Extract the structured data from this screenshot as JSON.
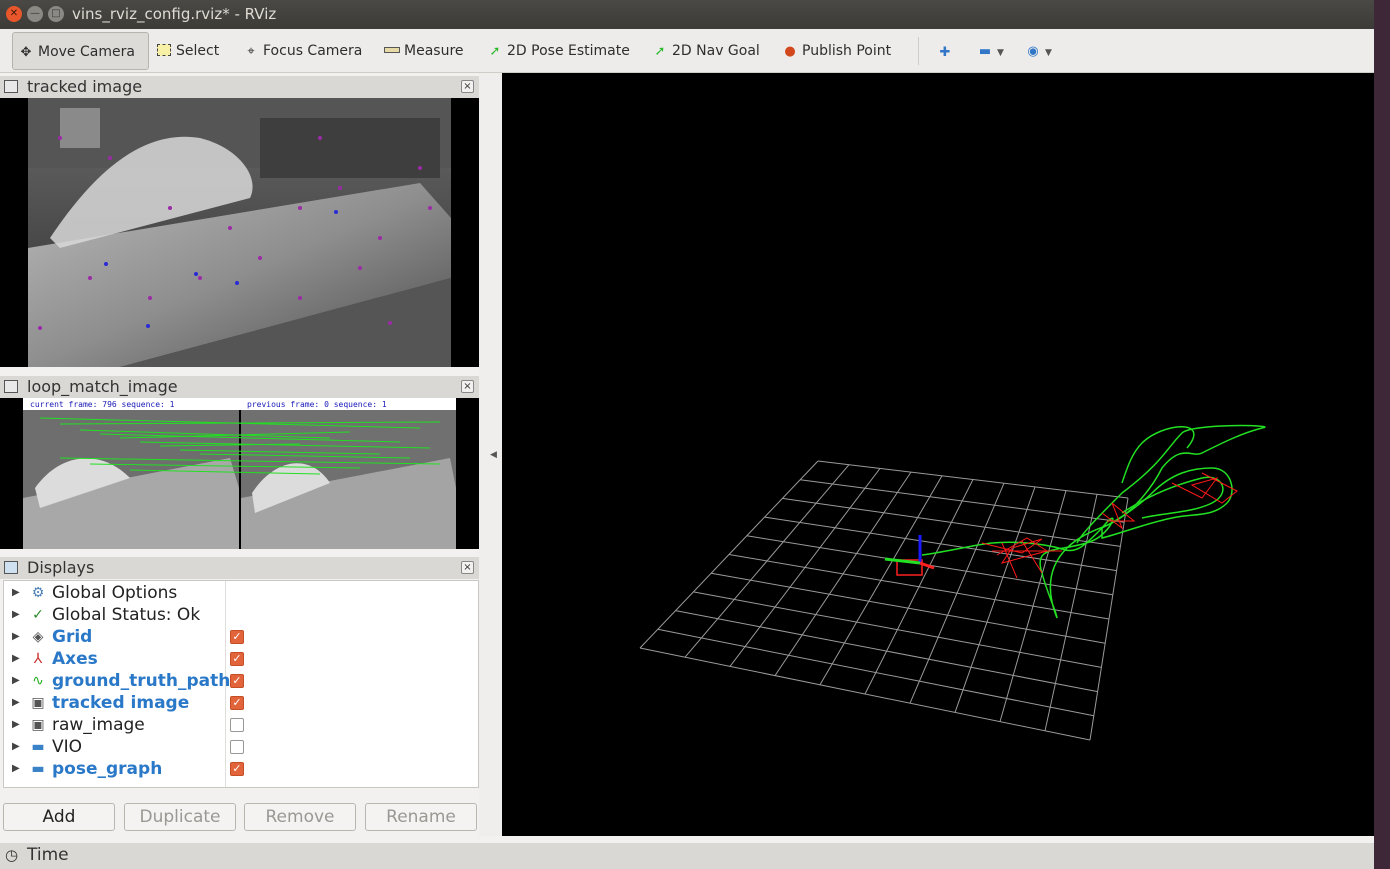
{
  "window": {
    "title": "vins_rviz_config.rviz* - RViz",
    "close": "✕",
    "minimize": "—",
    "maximize": "□"
  },
  "toolbar": {
    "move_camera": "Move Camera",
    "select": "Select",
    "focus_camera": "Focus Camera",
    "measure": "Measure",
    "pose_estimate": "2D Pose Estimate",
    "nav_goal": "2D Nav Goal",
    "publish_point": "Publish Point",
    "icons": [
      "move-camera-icon",
      "select-icon",
      "focus-camera-icon",
      "measure-icon",
      "pose-estimate-icon",
      "nav-goal-icon",
      "publish-point-icon",
      "add-tool-icon",
      "remove-tool-icon",
      "view-icon"
    ]
  },
  "panels": {
    "tracked": {
      "title": "tracked image",
      "close": "×"
    },
    "loop": {
      "title": "loop_match_image",
      "close": "×",
      "left_caption": "current frame: 796  sequence: 1",
      "right_caption": "previous frame: 0  sequence: 1"
    },
    "displays": {
      "title": "Displays",
      "close": "×"
    }
  },
  "displays": {
    "items": [
      {
        "label": "Global Options",
        "icon": "gear-icon",
        "blue": false,
        "checked": null
      },
      {
        "label": "Global Status: Ok",
        "icon": "check-icon",
        "blue": false,
        "checked": null
      },
      {
        "label": "Grid",
        "icon": "grid-icon",
        "blue": true,
        "checked": true
      },
      {
        "label": "Axes",
        "icon": "axes-icon",
        "blue": true,
        "checked": true
      },
      {
        "label": "ground_truth_path",
        "icon": "path-icon",
        "blue": true,
        "checked": true
      },
      {
        "label": "tracked image",
        "icon": "image-icon",
        "blue": true,
        "checked": true
      },
      {
        "label": "raw_image",
        "icon": "image-icon",
        "blue": false,
        "checked": false
      },
      {
        "label": "VIO",
        "icon": "folder-icon",
        "blue": false,
        "checked": false
      },
      {
        "label": "pose_graph",
        "icon": "folder-icon",
        "blue": true,
        "checked": true
      }
    ]
  },
  "buttons": {
    "add": "Add",
    "duplicate": "Duplicate",
    "remove": "Remove",
    "rename": "Rename"
  },
  "status": {
    "time": "Time"
  },
  "colors": {
    "accent_check": "#e2643a",
    "path_green": "#2ede2e",
    "loop_red": "#ff0000",
    "link_blue": "#2a78c8"
  }
}
